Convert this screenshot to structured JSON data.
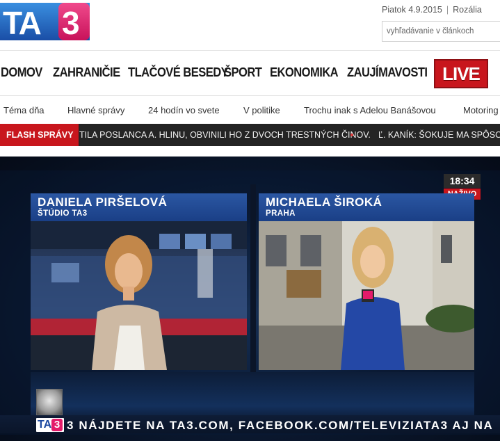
{
  "header": {
    "logo_text": "TA3",
    "date": "Piatok 4.9.2015",
    "separator": "|",
    "nameday": "Rozália",
    "search_placeholder": "vyhľadávanie v článkoch"
  },
  "main_nav": {
    "items": [
      "DOMOV",
      "ZAHRANIČIE",
      "TLAČOVÉ BESEDY",
      "ŠPORT",
      "EKONOMIKA",
      "ZAUJÍMAVOSTI"
    ],
    "live_label": "LIVE"
  },
  "sub_nav": {
    "items": [
      "Téma dňa",
      "Hlavné správy",
      "24 hodín vo svete",
      "V politike",
      "Trochu inak s Adelou Banášovou",
      "Motoring"
    ]
  },
  "flash": {
    "label": "FLASH SPRÁVY",
    "items": [
      "TILA POSLANCA A. HLINU, OBVINILI HO Z DVOCH TRESTNÝCH ČINOV.",
      "Ľ. KANÍK: ŠOKUJE MA SPÔSOB P"
    ]
  },
  "video": {
    "clock": "18:34",
    "live_tag": "NAŽIVO",
    "left_panel": {
      "name": "DANIELA PIRŠELOVÁ",
      "location": "ŠTÚDIO TA3"
    },
    "right_panel": {
      "name": "MICHAELA ŠIROKÁ",
      "location": "PRAHA"
    },
    "ticker_logo_ta": "TA",
    "ticker_logo_3": "3",
    "ticker_text": "3 NÁJDETE NA TA3.COM, FACEBOOK.COM/TELEVIZIATA3 AJ NA"
  },
  "colors": {
    "brand_blue": "#1e4aa0",
    "brand_pink": "#e41b6a",
    "live_red": "#c8161d",
    "flash_bg": "#242424"
  }
}
